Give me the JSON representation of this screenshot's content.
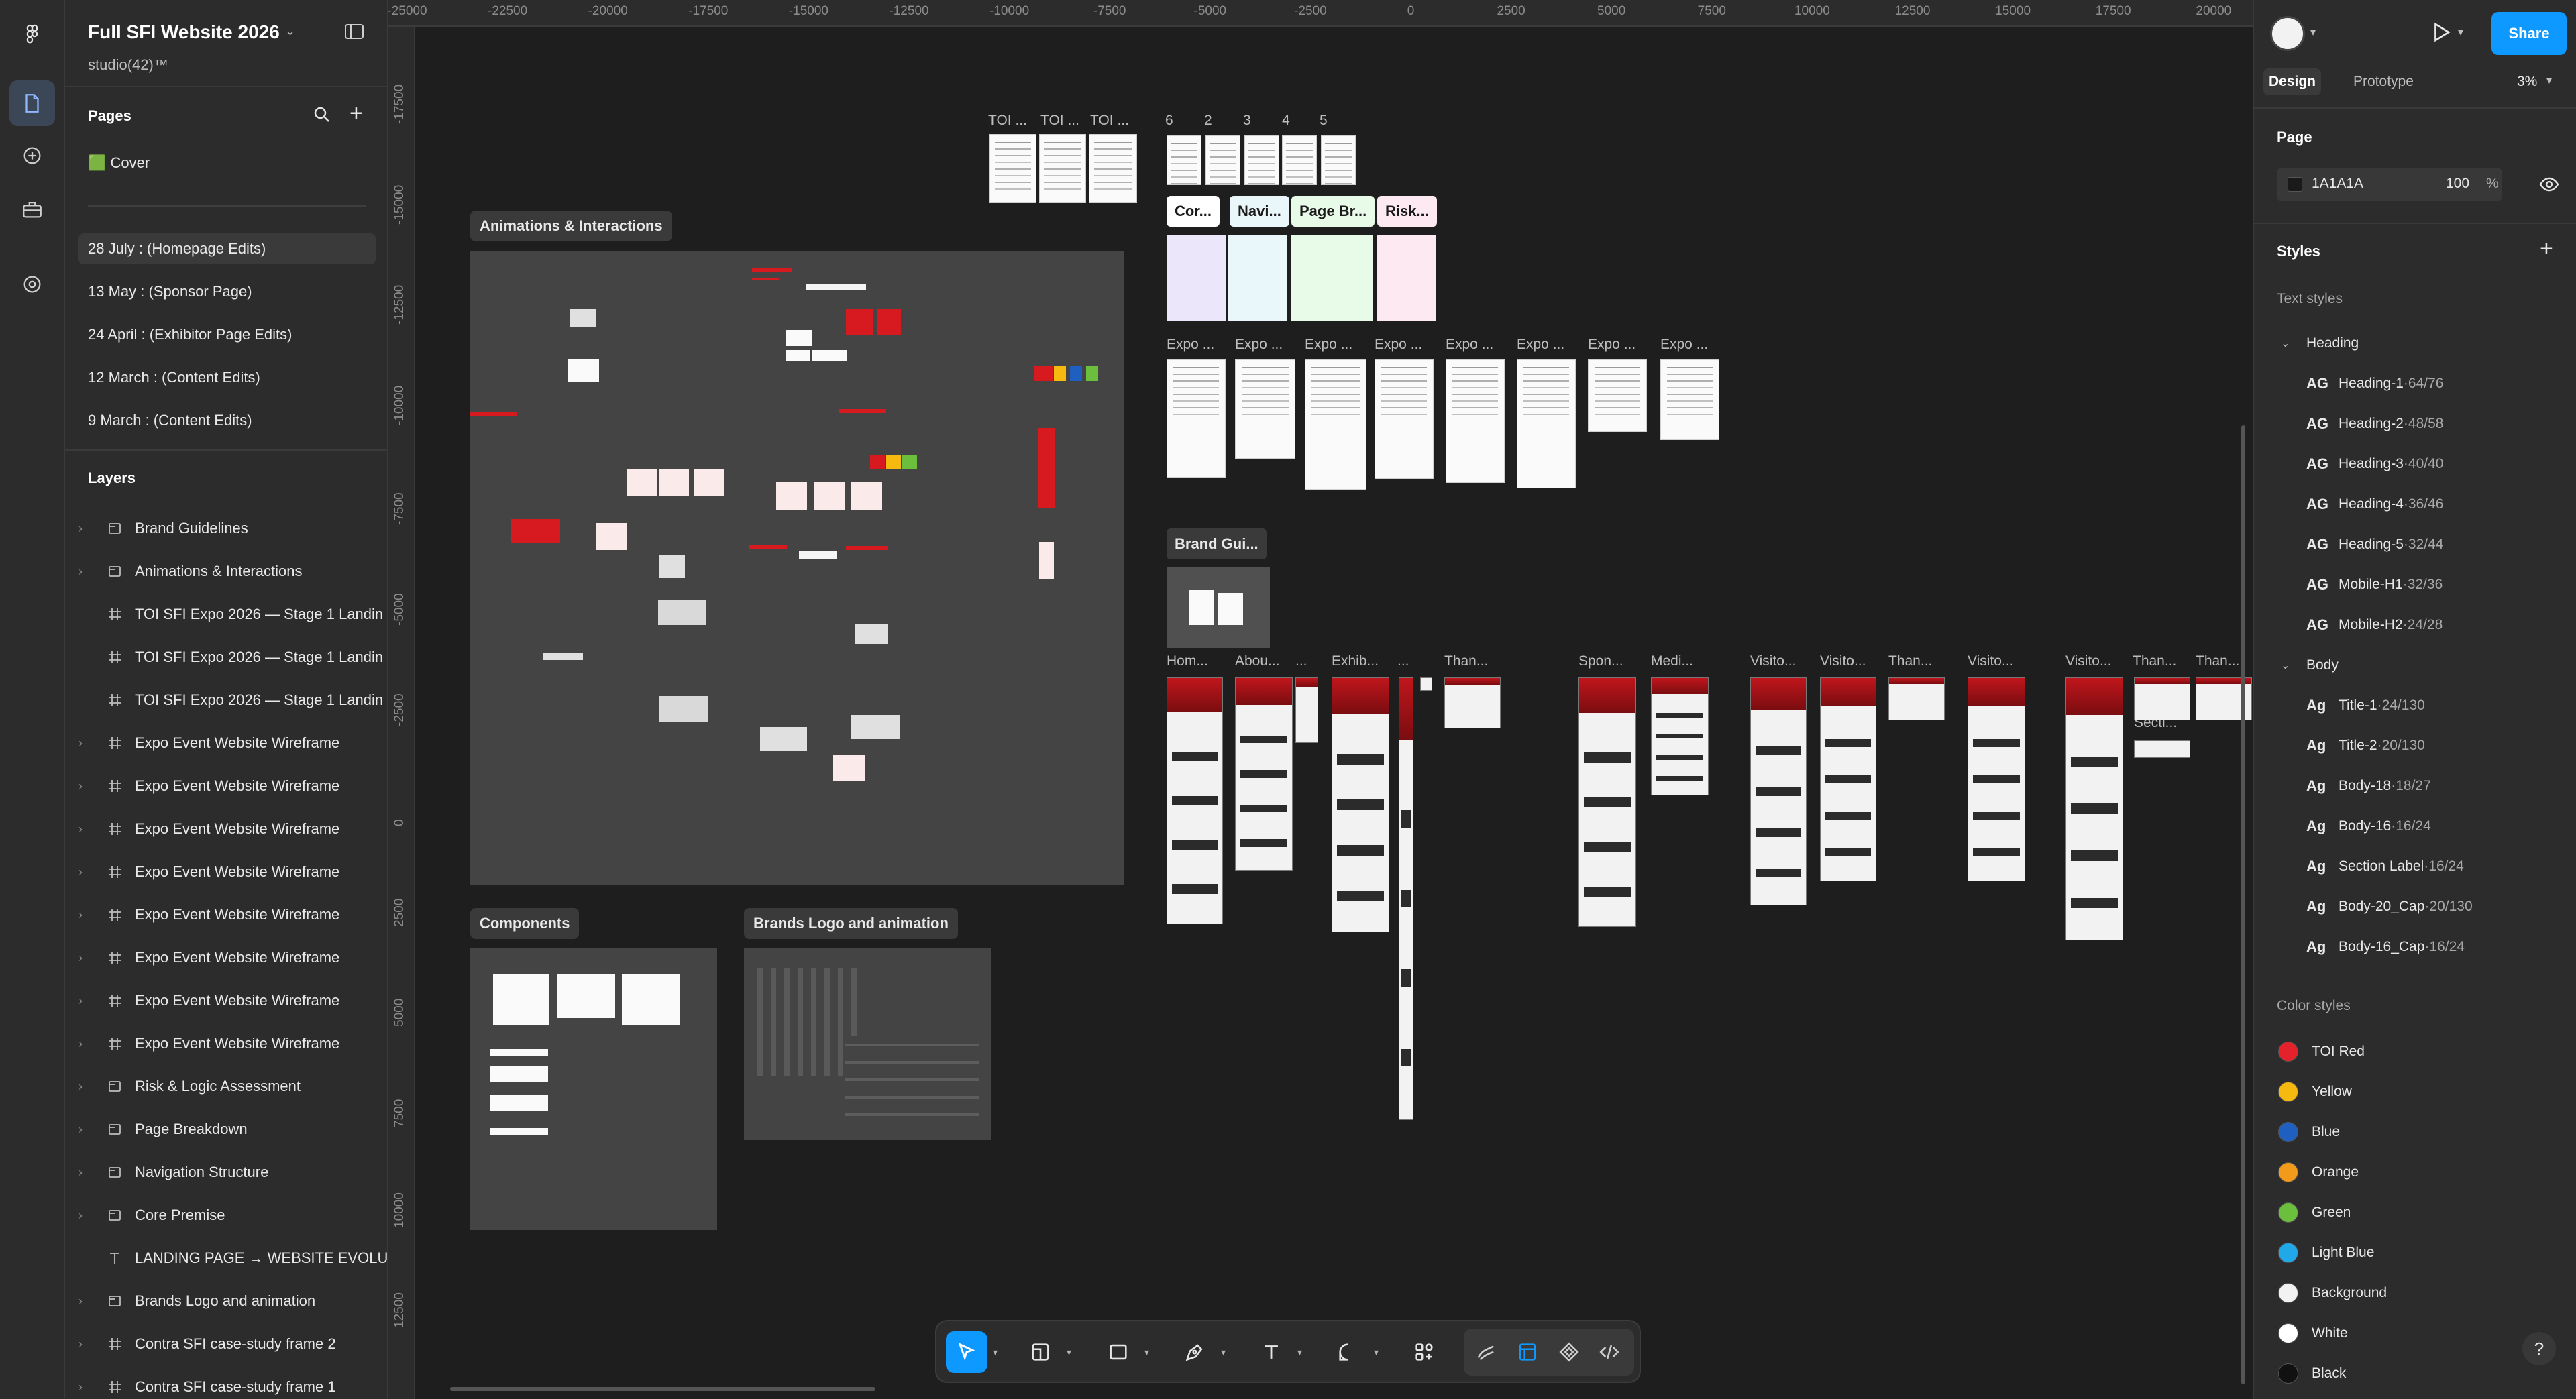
{
  "file": {
    "name": "Full SFI Website 2026",
    "team": "studio(42)™"
  },
  "pages": {
    "header": "Pages",
    "items": [
      {
        "label": "Cover",
        "emoji": "🟩"
      },
      {
        "label": "28 July : (Homepage Edits)"
      },
      {
        "label": "13 May : (Sponsor Page)"
      },
      {
        "label": "24 April : (Exhibitor Page Edits)"
      },
      {
        "label": "12 March : (Content Edits)"
      },
      {
        "label": "9 March : (Content Edits)"
      }
    ]
  },
  "layers": {
    "header": "Layers",
    "items": [
      {
        "label": "Brand Guidelines",
        "type": "section",
        "expandable": true
      },
      {
        "label": "Animations & Interactions",
        "type": "section",
        "expandable": true
      },
      {
        "label": "TOI SFI Expo 2026 — Stage 1 Landin",
        "type": "frame",
        "expandable": false
      },
      {
        "label": "TOI SFI Expo 2026 — Stage 1 Landin",
        "type": "frame",
        "expandable": false
      },
      {
        "label": "TOI SFI Expo 2026 — Stage 1 Landin",
        "type": "frame",
        "expandable": false
      },
      {
        "label": "Expo Event Website Wireframe",
        "type": "frame",
        "expandable": true
      },
      {
        "label": "Expo Event Website Wireframe",
        "type": "frame",
        "expandable": true
      },
      {
        "label": "Expo Event Website Wireframe",
        "type": "frame",
        "expandable": true
      },
      {
        "label": "Expo Event Website Wireframe",
        "type": "frame",
        "expandable": true
      },
      {
        "label": "Expo Event Website Wireframe",
        "type": "frame",
        "expandable": true
      },
      {
        "label": "Expo Event Website Wireframe",
        "type": "frame",
        "expandable": true
      },
      {
        "label": "Expo Event Website Wireframe",
        "type": "frame",
        "expandable": true
      },
      {
        "label": "Expo Event Website Wireframe",
        "type": "frame",
        "expandable": true
      },
      {
        "label": "Risk & Logic Assessment",
        "type": "section",
        "expandable": true
      },
      {
        "label": "Page Breakdown",
        "type": "section",
        "expandable": true
      },
      {
        "label": "Navigation Structure",
        "type": "section",
        "expandable": true
      },
      {
        "label": "Core Premise",
        "type": "section",
        "expandable": true
      },
      {
        "label": "LANDING PAGE → WEBSITE EVOLUT",
        "type": "text",
        "expandable": false
      },
      {
        "label": "Brands Logo and animation",
        "type": "section",
        "expandable": true
      },
      {
        "label": "Contra SFI case-study frame 2",
        "type": "frame",
        "expandable": true
      },
      {
        "label": "Contra SFI case-study frame 1",
        "type": "frame",
        "expandable": true
      }
    ]
  },
  "ruler": {
    "top": [
      "-25000",
      "-22500",
      "-20000",
      "-17500",
      "-15000",
      "-12500",
      "-10000",
      "-7500",
      "-5000",
      "-2500",
      "0",
      "2500",
      "5000",
      "7500",
      "10000",
      "12500",
      "15000",
      "17500",
      "20000"
    ],
    "left": [
      "-17500",
      "-15000",
      "-12500",
      "-10000",
      "-7500",
      "-5000",
      "-2500",
      "0",
      "2500",
      "5000",
      "7500",
      "10000",
      "12500"
    ]
  },
  "canvas": {
    "sections": {
      "animations": "Animations & Interactions",
      "components": "Components",
      "brands": "Brands Logo and animation",
      "brand_gui": "Brand Gui..."
    },
    "toi_labels": [
      "TOI ...",
      "TOI ...",
      "TOI ..."
    ],
    "num_labels": [
      "6",
      "2",
      "3",
      "4",
      "5"
    ],
    "tags": [
      "Cor...",
      "Navi...",
      "Page Br...",
      "Risk..."
    ],
    "expo_labels": [
      "Expo ...",
      "Expo ...",
      "Expo ...",
      "Expo ...",
      "Expo ...",
      "Expo ...",
      "Expo ...",
      "Expo ..."
    ],
    "web_labels": [
      "Hom...",
      "Abou...",
      "...",
      "Exhib...",
      "...",
      "Than...",
      "Spon...",
      "Medi...",
      "Visito...",
      "Visito...",
      "Than...",
      "Visito...",
      "Visito...",
      "Than...",
      "Than...",
      "Secti..."
    ]
  },
  "right": {
    "tabs": {
      "design": "Design",
      "prototype": "Prototype"
    },
    "zoom": "3%",
    "share": "Share",
    "page_section": "Page",
    "page_color": "1A1A1A",
    "page_opacity": "100",
    "percent": "%",
    "styles_header": "Styles",
    "text_styles": "Text styles",
    "groups": [
      {
        "name": "Heading",
        "items": [
          {
            "label": "Heading-1",
            "spec": "64/76"
          },
          {
            "label": "Heading-2",
            "spec": "48/58"
          },
          {
            "label": "Heading-3",
            "spec": "40/40"
          },
          {
            "label": "Heading-4",
            "spec": "36/46"
          },
          {
            "label": "Heading-5",
            "spec": "32/44"
          },
          {
            "label": "Mobile-H1",
            "spec": "32/36"
          },
          {
            "label": "Mobile-H2",
            "spec": "24/28"
          }
        ]
      },
      {
        "name": "Body",
        "items": [
          {
            "label": "Title-1",
            "spec": "24/130"
          },
          {
            "label": "Title-2",
            "spec": "20/130"
          },
          {
            "label": "Body-18",
            "spec": "18/27"
          },
          {
            "label": "Body-16",
            "spec": "16/24"
          },
          {
            "label": "Section Label",
            "spec": "16/24"
          },
          {
            "label": "Body-20_Cap",
            "spec": "20/130"
          },
          {
            "label": "Body-16_Cap",
            "spec": "16/24"
          }
        ]
      }
    ],
    "color_styles_header": "Color styles",
    "colors": [
      {
        "label": "TOI Red",
        "hex": "#e5212b"
      },
      {
        "label": "Yellow",
        "hex": "#f5b90f"
      },
      {
        "label": "Blue",
        "hex": "#1f5fbf"
      },
      {
        "label": "Orange",
        "hex": "#f29a1a"
      },
      {
        "label": "Green",
        "hex": "#6cbf3d"
      },
      {
        "label": "Light Blue",
        "hex": "#21a8e8"
      },
      {
        "label": "Background",
        "hex": "#f2f2f2"
      },
      {
        "label": "White",
        "hex": "#ffffff"
      },
      {
        "label": "Black",
        "hex": "#111111"
      }
    ],
    "help": "?"
  },
  "accent": "#0d99ff"
}
